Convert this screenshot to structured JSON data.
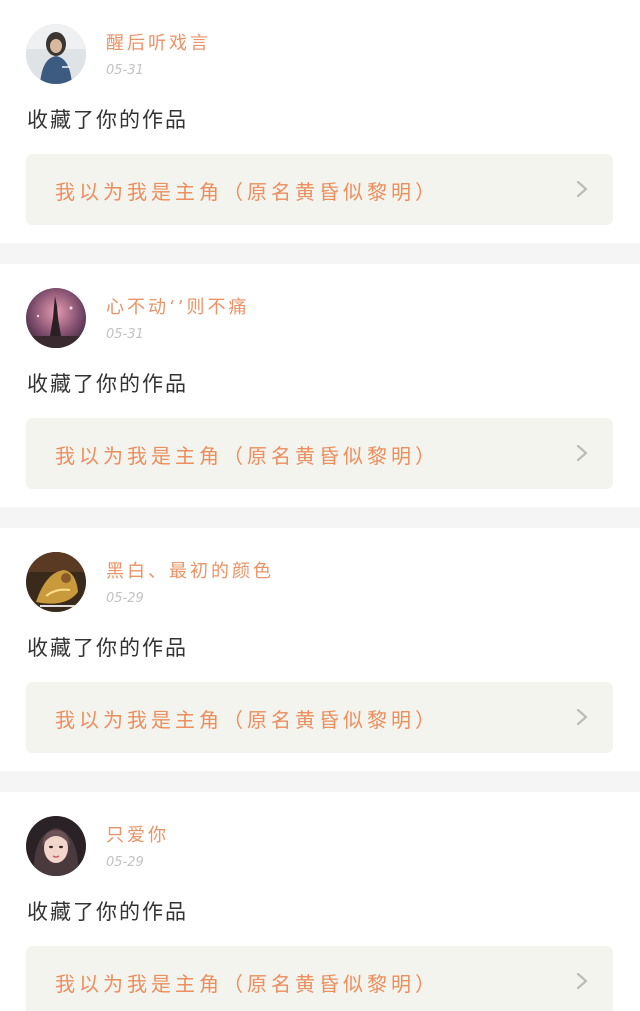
{
  "feed": {
    "items": [
      {
        "username": "醒后听戏言",
        "time": "05-31",
        "action": "收藏了你的作品",
        "work_title": "我以为我是主角（原名黄昏似黎明）",
        "avatar_icon": "avatar-dark-hair-person-icon"
      },
      {
        "username": "心不动‘’则不痛",
        "time": "05-31",
        "action": "收藏了你的作品",
        "work_title": "我以为我是主角（原名黄昏似黎明）",
        "avatar_icon": "avatar-eiffel-tower-icon"
      },
      {
        "username": "黑白、最初的颜色",
        "time": "05-29",
        "action": "收藏了你的作品",
        "work_title": "我以为我是主角（原名黄昏似黎明）",
        "avatar_icon": "avatar-gold-figure-icon"
      },
      {
        "username": "只爱你",
        "time": "05-29",
        "action": "收藏了你的作品",
        "work_title": "我以为我是主角（原名黄昏似黎明）",
        "avatar_icon": "avatar-girl-portrait-icon"
      }
    ]
  },
  "colors": {
    "accent": "#e89469",
    "card_bg": "#f4f4ee",
    "divider": "#f5f5f5",
    "text": "#333333",
    "muted": "#c2c2c2"
  }
}
